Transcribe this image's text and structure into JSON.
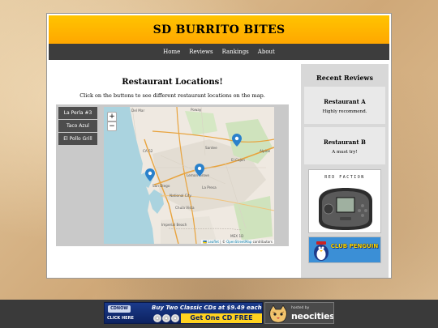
{
  "header": {
    "title": "SD BURRITO BITES"
  },
  "nav": {
    "items": [
      "Home",
      "Reviews",
      "Rankings",
      "About"
    ]
  },
  "locations": {
    "title": "Restaurant Locations!",
    "subtitle": "Click on the buttons to see different restaurant locations on the map.",
    "buttons": [
      "La Perla #3",
      "Taco Azul",
      "El Pollo Grill"
    ]
  },
  "map": {
    "zoom_in": "+",
    "zoom_out": "−",
    "attribution_leaflet": "🇺🇦 Leaflet",
    "attribution_sep": " | © ",
    "attribution_osm": "OpenStreetMap",
    "attribution_tail": " contributors",
    "place_labels": [
      "Del Mar",
      "Poway",
      "Santee",
      "El Cajon",
      "San Diego",
      "Lemon Grove",
      "National City",
      "Chula Vista",
      "Imperial Beach",
      "La Presa",
      "Alpine",
      "CA 52",
      "MEX 1D"
    ]
  },
  "sidebar": {
    "title": "Recent Reviews",
    "reviews": [
      {
        "name": "Restaurant A",
        "text": "Highly recommend."
      },
      {
        "name": "Restaurant B",
        "text": "A must try!"
      }
    ],
    "ad1_text": "RED FACTION",
    "ad2_text": "CLUB PENGUIN"
  },
  "footer": {
    "banner_logo": "CDNOW",
    "banner_line1": "Buy Two Classic CDs at $9.49 each",
    "banner_clickhere": "CLICK HERE",
    "banner_cta": "Get One CD FREE",
    "neocities_small": "hosted by",
    "neocities_big": "neocities"
  },
  "colors": {
    "header_bg": "#ffb400",
    "nav_bg": "#3d3d3d",
    "sidebar_bg": "#d8d8d8",
    "pin": "#2a81cb",
    "footer_bg": "#3a3a3a"
  }
}
